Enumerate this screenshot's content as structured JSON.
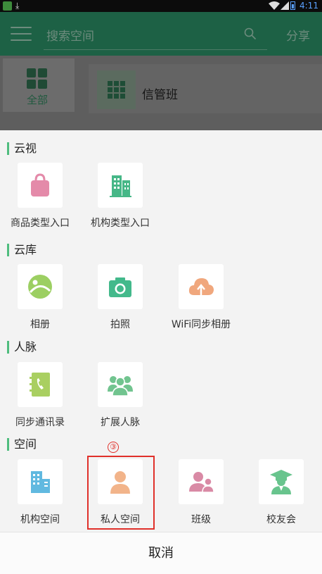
{
  "status_bar": {
    "time": "4:11",
    "icons": [
      "app-icon",
      "download-icon",
      "wifi-icon",
      "signal-icon",
      "battery-icon"
    ]
  },
  "header": {
    "search_placeholder": "搜索空间",
    "share_label": "分享"
  },
  "background": {
    "sidebar_all_label": "全部",
    "space_name": "信管班"
  },
  "sheet": {
    "sections": [
      {
        "title": "云视",
        "items": [
          {
            "label": "商品类型入口",
            "icon": "shopping-bag-icon",
            "color": "#e48aa9"
          },
          {
            "label": "机构类型入口",
            "icon": "building-icon",
            "color": "#46b787"
          }
        ]
      },
      {
        "title": "云库",
        "items": [
          {
            "label": "相册",
            "icon": "album-icon",
            "color": "#9ccf62"
          },
          {
            "label": "拍照",
            "icon": "camera-icon",
            "color": "#43b98b"
          },
          {
            "label": "WiFi同步相册",
            "icon": "cloud-upload-icon",
            "color": "#f0a77d"
          }
        ]
      },
      {
        "title": "人脉",
        "items": [
          {
            "label": "同步通讯录",
            "icon": "contacts-book-icon",
            "color": "#a9cf61"
          },
          {
            "label": "扩展人脉",
            "icon": "people-group-icon",
            "color": "#71c48f"
          }
        ]
      },
      {
        "title": "空间",
        "items": [
          {
            "label": "机构空间",
            "icon": "office-building-icon",
            "color": "#61b9e0"
          },
          {
            "label": "私人空间",
            "icon": "person-icon",
            "color": "#f2b48a"
          },
          {
            "label": "班级",
            "icon": "class-people-icon",
            "color": "#d98aa5"
          },
          {
            "label": "校友会",
            "icon": "graduate-icon",
            "color": "#68c48d"
          }
        ]
      }
    ],
    "highlight_badge": "③",
    "cancel_label": "取消"
  }
}
